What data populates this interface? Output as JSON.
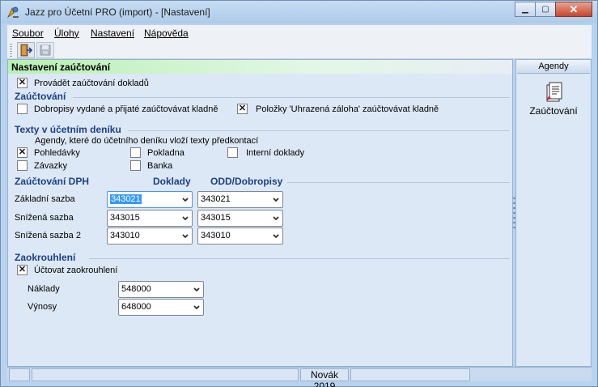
{
  "window": {
    "title": "Jazz pro Účetní PRO (import) - [Nastavení]",
    "controls": {
      "minimize": "▭",
      "maximize": "□",
      "close": "✕"
    }
  },
  "menu": [
    "Soubor",
    "Úlohy",
    "Nastavení",
    "Nápověda"
  ],
  "toolbar": {
    "items": [
      "exit-icon",
      "save-icon"
    ]
  },
  "panel": {
    "header": "Nastavení zaúčtování",
    "provadet": {
      "label": "Provádět zaúčtování dokladů",
      "checked": true
    }
  },
  "zauctovani": {
    "title": "Zaúčtování",
    "dobropisy": {
      "label": "Dobropisy vydané a přijaté zaúčtovávat kladně",
      "checked": false
    },
    "polozky": {
      "label": "Položky 'Uhrazená záloha' zaúčtovávat kladně",
      "checked": true
    }
  },
  "texty": {
    "title": "Texty v účetním deníku",
    "note": "Agendy, které do účetního deníku vloží texty předkontací",
    "items": [
      {
        "label": "Pohledávky",
        "checked": true
      },
      {
        "label": "Pokladna",
        "checked": false
      },
      {
        "label": "Interní doklady",
        "checked": false
      },
      {
        "label": "Závazky",
        "checked": false
      },
      {
        "label": "Banka",
        "checked": false
      }
    ]
  },
  "dph": {
    "title": "Zaúčtování DPH",
    "col_doklady": "Doklady",
    "col_odd": "ODD/Dobropisy",
    "rows": [
      {
        "label": "Základní sazba",
        "doklady": "343021",
        "odd": "343021"
      },
      {
        "label": "Snížená sazba",
        "doklady": "343015",
        "odd": "343015"
      },
      {
        "label": "Snížená sazba 2",
        "doklady": "343010",
        "odd": "343010"
      }
    ]
  },
  "zaokrouhleni": {
    "title": "Zaokrouhlení",
    "uctovat": {
      "label": "Účtovat zaokrouhlení",
      "checked": true
    },
    "naklady": {
      "label": "Náklady",
      "value": "548000"
    },
    "vynosy": {
      "label": "Výnosy",
      "value": "648000"
    }
  },
  "agendy": {
    "header": "Agendy",
    "item": "Zaúčtování"
  },
  "status": {
    "cells": [
      "",
      "",
      "Novák 2019",
      ""
    ]
  },
  "check_mark": "✕"
}
